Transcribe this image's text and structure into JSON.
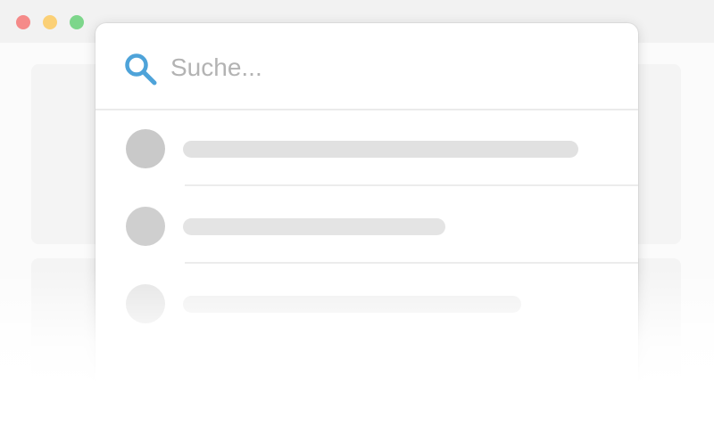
{
  "colors": {
    "traffic_close": "#f58a89",
    "traffic_minimize": "#fbd076",
    "traffic_maximize": "#7dd68b",
    "search_icon": "#4ea3d9"
  },
  "browser": {
    "window_controls": [
      "close",
      "minimize",
      "maximize"
    ]
  },
  "search": {
    "icon": "search-icon",
    "placeholder": "Suche...",
    "value": ""
  },
  "results": {
    "state": "loading-skeleton",
    "count": 3
  }
}
